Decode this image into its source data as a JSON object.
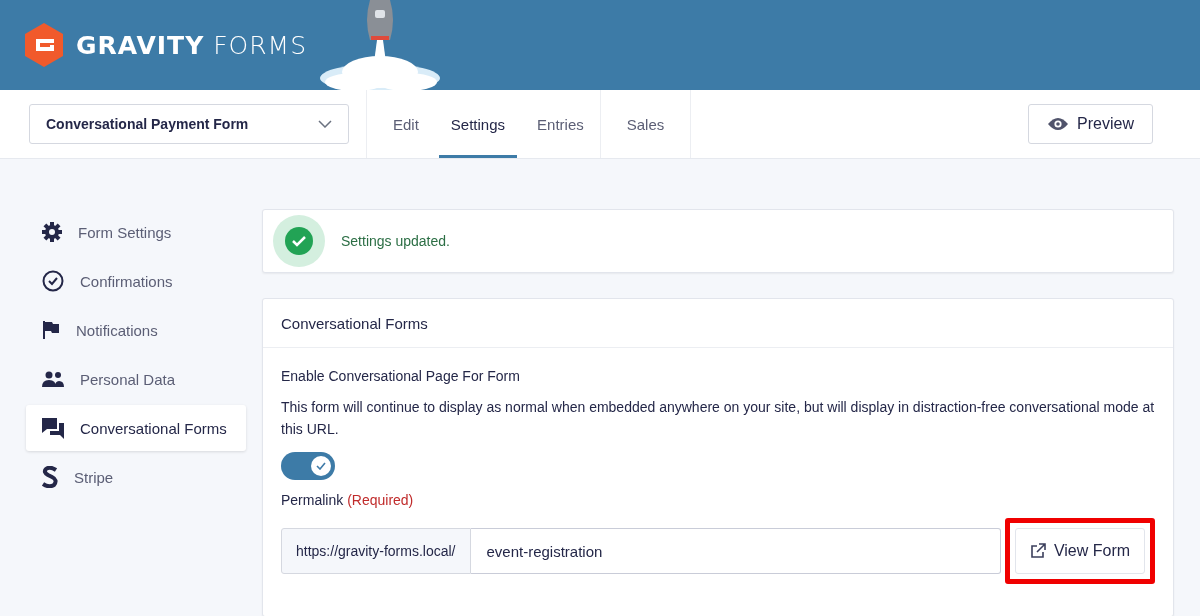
{
  "header": {
    "logo": "**GRAVITY** FORMS"
  },
  "form_select": {
    "value": "Conversational Payment Form"
  },
  "tabs": [
    {
      "label": "Edit",
      "selected": false
    },
    {
      "label": "Settings",
      "selected": true
    },
    {
      "label": "Entries",
      "selected": false
    },
    {
      "label": "Sales",
      "selected": false
    }
  ],
  "preview_button": "Preview",
  "sidebar": {
    "items": [
      {
        "label": "Form Settings",
        "selected": false
      },
      {
        "label": "Confirmations",
        "selected": false
      },
      {
        "label": "Notifications",
        "selected": false
      },
      {
        "label": "Personal Data",
        "selected": false
      },
      {
        "label": "Conversational Forms",
        "selected": true
      },
      {
        "label": "Stripe",
        "selected": false
      }
    ]
  },
  "notice": {
    "text": "Settings updated."
  },
  "panel": {
    "title": "Conversational Forms",
    "field_label": "Enable Conversational Page For Form",
    "description": "This form will continue to display as normal when embedded anywhere on your site, but will display in distraction-free conversational mode at this URL.",
    "toggle": {
      "on": true
    },
    "permalink_label": "Permalink",
    "required": "(Required)",
    "prefix": "https://gravity-forms.local/",
    "slug": "event-registration",
    "view_button": {
      "label": "View Form",
      "highlighted": true
    }
  }
}
